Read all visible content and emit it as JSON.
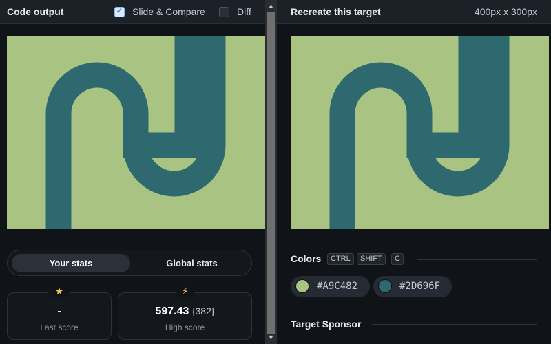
{
  "left_panel": {
    "title": "Code output",
    "slide_compare": {
      "label": "Slide & Compare",
      "checked": true
    },
    "diff": {
      "label": "Diff",
      "checked": false
    },
    "tabs": [
      {
        "label": "Your stats",
        "active": true
      },
      {
        "label": "Global stats",
        "active": false
      }
    ],
    "stats": {
      "last_score": {
        "value": "-",
        "label": "Last score",
        "icon": "star-icon"
      },
      "high_score": {
        "value": "597.43",
        "sub": "{382}",
        "label": "High score",
        "icon": "lightning-icon"
      }
    }
  },
  "right_panel": {
    "title": "Recreate this target",
    "size": "400px x 300px",
    "colors": {
      "label": "Colors",
      "shortcut": [
        "CTRL",
        "SHIFT",
        "C"
      ],
      "swatches": [
        {
          "hex": "#A9C482",
          "color": "#a9c482"
        },
        {
          "hex": "#2D696F",
          "color": "#2d696f"
        }
      ]
    },
    "sponsor_label": "Target Sponsor"
  },
  "theme": {
    "background": "#101318",
    "header": "#1c2027",
    "canvas_bg": "#a9c482",
    "shape": "#2d696f",
    "accent": "#f6c64a"
  }
}
